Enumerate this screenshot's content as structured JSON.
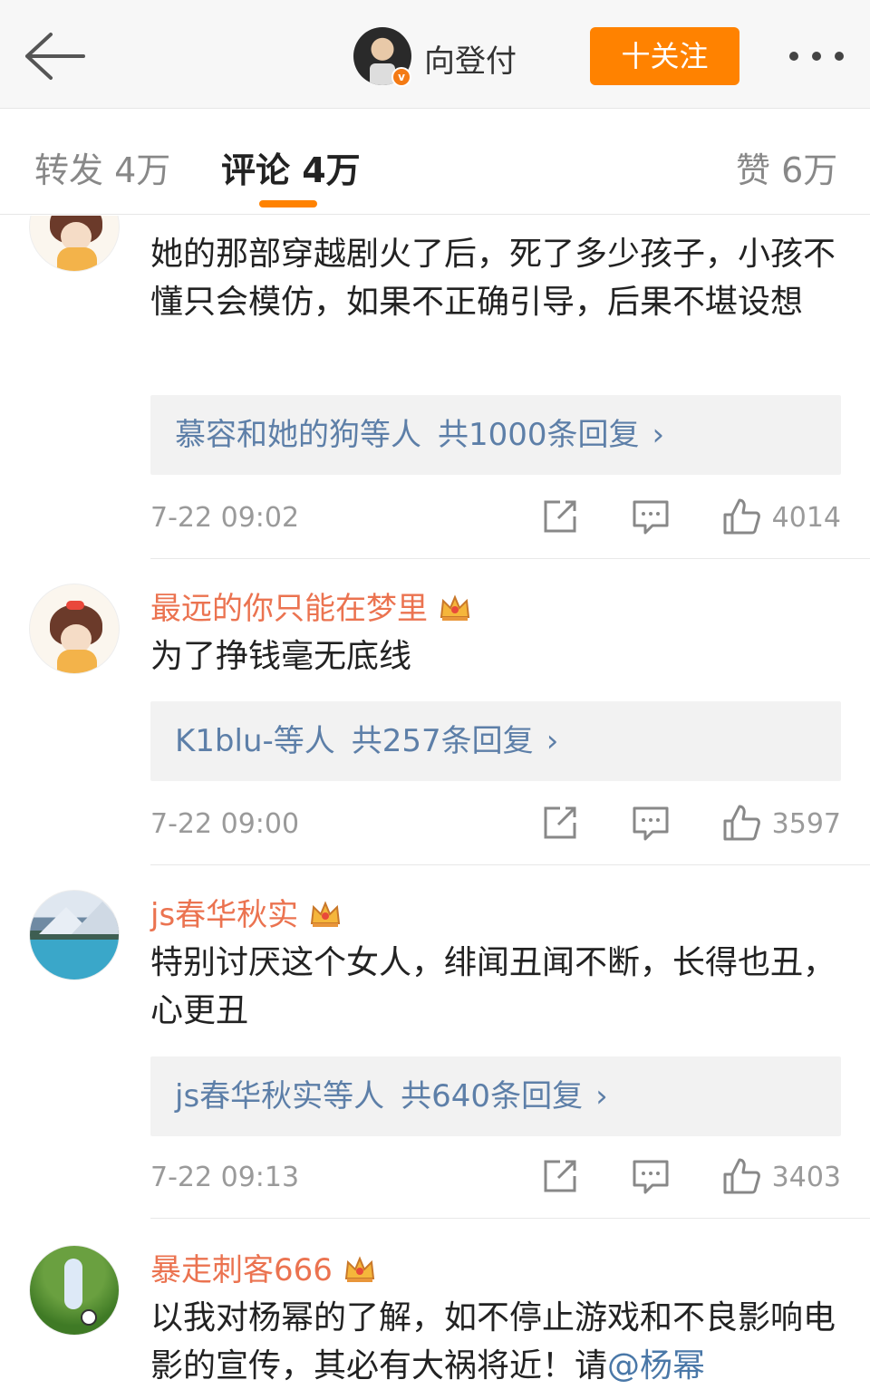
{
  "header": {
    "author_name": "向登付",
    "follow_label": "十关注",
    "verified_mark": "v"
  },
  "tabs": {
    "repost": "转发 4万",
    "comments": "评论 4万",
    "likes": "赞 6万"
  },
  "comments": [
    {
      "username": "",
      "text": "她的那部穿越剧火了后，死了多少孩子，小孩不懂只会模仿，如果不正确引导，后果不堪设想",
      "reply_who": "慕容和她的狗等人",
      "reply_count": "共1000条回复",
      "time": "7-22 09:02",
      "likes": "4014",
      "avatar": "girl"
    },
    {
      "username": "最远的你只能在梦里",
      "text": "为了挣钱毫无底线",
      "reply_who": "K1blu-等人",
      "reply_count": "共257条回复",
      "time": "7-22 09:00",
      "likes": "3597",
      "avatar": "girl"
    },
    {
      "username": "js春华秋实",
      "text": "特别讨厌这个女人，绯闻丑闻不断，长得也丑，心更丑",
      "reply_who": "js春华秋实等人",
      "reply_count": "共640条回复",
      "time": "7-22 09:13",
      "likes": "3403",
      "avatar": "lake"
    },
    {
      "username": "暴走刺客666",
      "text_before": "以我对杨幂的了解，如不停止游戏和不良影响电影的宣传，其必有大祸将近！请",
      "mention": "@杨幂",
      "avatar": "soccer"
    }
  ],
  "icons": {
    "back": "back-arrow-icon",
    "more": "more-dots-icon",
    "crown": "crown-icon",
    "share": "share-icon",
    "comment": "comment-icon",
    "like": "thumbs-up-icon",
    "chevron": "chevron-right-icon"
  },
  "colors": {
    "accent": "#ff8200",
    "username": "#eb7350",
    "link": "#5d7fa8"
  },
  "chevron_glyph": "›"
}
